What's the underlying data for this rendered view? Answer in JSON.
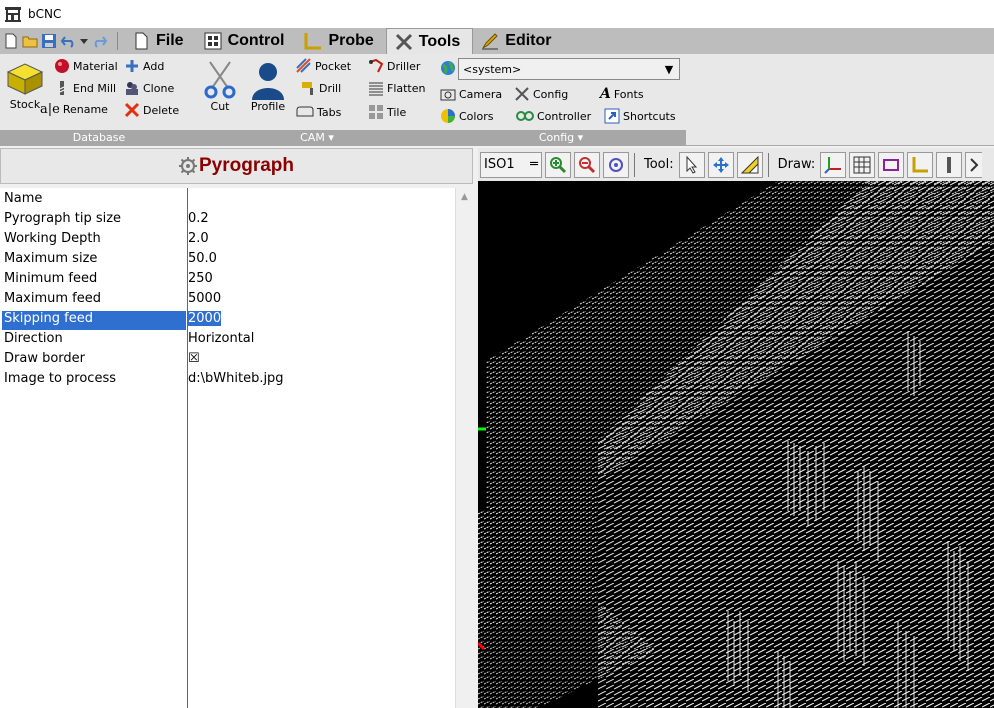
{
  "window": {
    "title": "bCNC"
  },
  "tabs": [
    {
      "label": "File",
      "icon": "file-icon"
    },
    {
      "label": "Control",
      "icon": "control-icon"
    },
    {
      "label": "Probe",
      "icon": "probe-icon"
    },
    {
      "label": "Tools",
      "icon": "tools-icon",
      "active": true
    },
    {
      "label": "Editor",
      "icon": "editor-icon"
    }
  ],
  "ribbon": {
    "database": {
      "label": "Database",
      "stock": "Stock",
      "material": "Material",
      "end_mill": "End Mill",
      "rename": "Rename",
      "add": "Add",
      "clone": "Clone",
      "delete": "Delete"
    },
    "cam": {
      "label": "CAM",
      "cut": "Cut",
      "profile": "Profile",
      "pocket": "Pocket",
      "drill": "Drill",
      "tabs": "Tabs",
      "driller": "Driller",
      "flatten": "Flatten",
      "tile": "Tile"
    },
    "config": {
      "label": "Config",
      "system_select": "<system>",
      "camera": "Camera",
      "config": "Config",
      "fonts": "Fonts",
      "colors": "Colors",
      "controller": "Controller",
      "shortcuts": "Shortcuts"
    }
  },
  "panel": {
    "title": "Pyrograph",
    "properties": [
      {
        "name": "Name",
        "value": ""
      },
      {
        "name": "Pyrograph tip size",
        "value": "0.2"
      },
      {
        "name": "Working Depth",
        "value": "2.0"
      },
      {
        "name": "Maximum size",
        "value": "50.0"
      },
      {
        "name": "Minimum feed",
        "value": "250"
      },
      {
        "name": "Maximum feed",
        "value": "5000"
      },
      {
        "name": "Skipping feed",
        "value": "2000",
        "selected": true
      },
      {
        "name": "Direction",
        "value": "Horizontal"
      },
      {
        "name": "Draw border",
        "value": "☒"
      },
      {
        "name": "Image to process",
        "value": "d:\\bWhiteb.jpg"
      }
    ]
  },
  "canvas_toolbar": {
    "view": "ISO1",
    "tool_label": "Tool:",
    "draw_label": "Draw:"
  },
  "colors": {
    "selection": "#2f6fd0",
    "panel_title": "#8b0000",
    "canvas_bg": "#000000"
  }
}
